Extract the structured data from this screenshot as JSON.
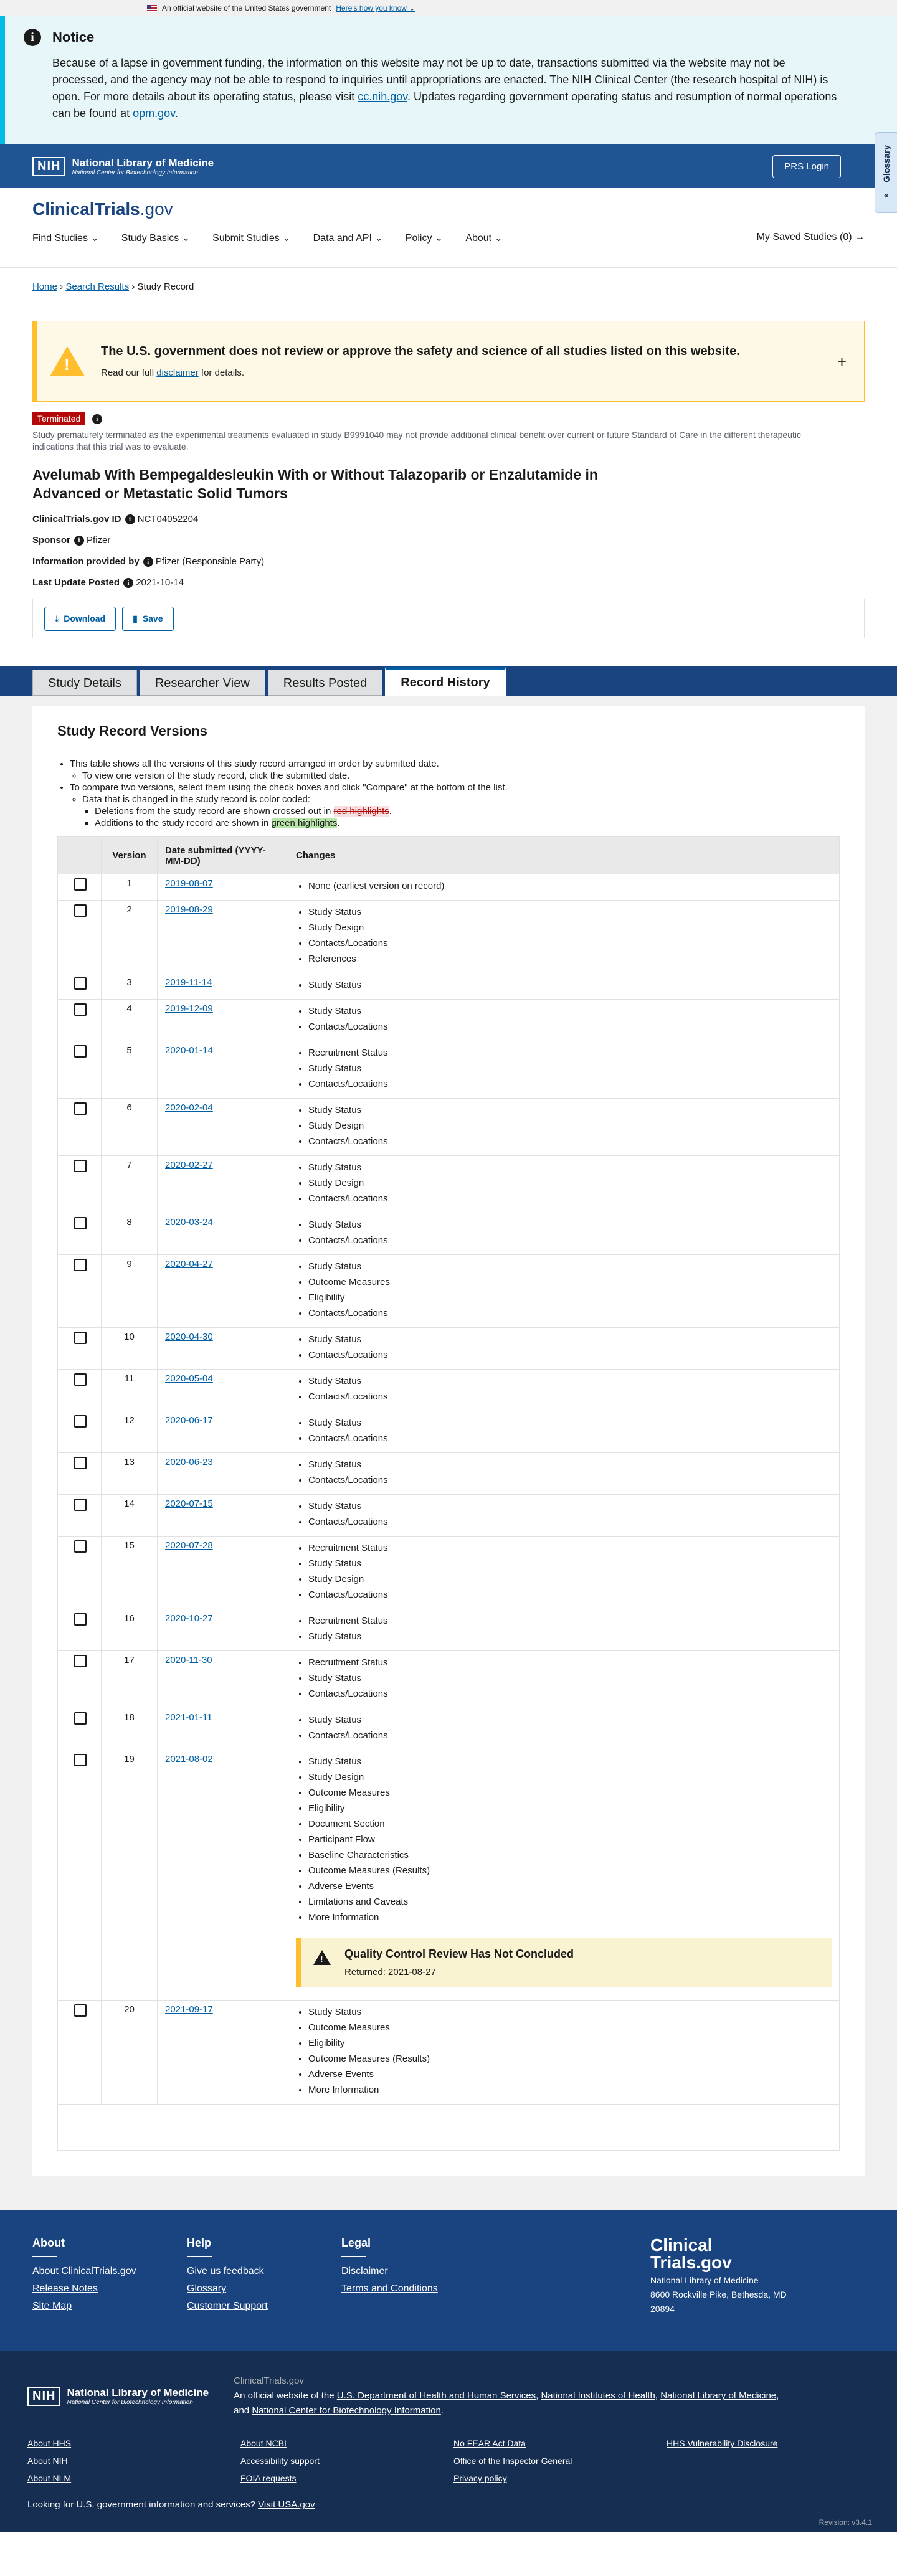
{
  "gov_banner": {
    "text": "An official website of the United States government",
    "link": "Here's how you know"
  },
  "notice": {
    "title": "Notice",
    "body_1": "Because of a lapse in government funding, the information on this website may not be up to date, transactions submitted via the website may not be processed, and the agency may not be able to respond to inquiries until appropriations are enacted. The NIH Clinical Center (the research hospital of NIH) is open. For more details about its operating status, please visit ",
    "link_1": "cc.nih.gov",
    "body_2": ". Updates regarding government operating status and resumption of normal operations can be found at ",
    "link_2": "opm.gov",
    "body_3": "."
  },
  "glossary_tab": "Glossary",
  "nih_bar": {
    "logo_box": "NIH",
    "logo_title": "National Library of Medicine",
    "logo_sub": "National Center for Biotechnology Information",
    "prs_login": "PRS Login"
  },
  "site": {
    "title_bold": "ClinicalTrials",
    "title_suffix": ".gov"
  },
  "nav": {
    "items": [
      "Find Studies",
      "Study Basics",
      "Submit Studies",
      "Data and API",
      "Policy",
      "About"
    ],
    "saved": "My Saved Studies (0)"
  },
  "breadcrumb": {
    "home": "Home",
    "search": "Search Results",
    "current": "Study Record"
  },
  "disclaimer": {
    "title": "The U.S. government does not review or approve the safety and science of all studies listed on this website.",
    "pre": "Read our full ",
    "link": "disclaimer",
    "post": " for details."
  },
  "study": {
    "status_badge": "Terminated",
    "reason": "Study prematurely terminated as the experimental treatments evaluated in study B9991040 may not provide additional clinical benefit over current or future Standard of Care in the different therapeutic indications that this trial was to evaluate.",
    "title": "Avelumab With Bempegaldesleukin With or Without Talazoparib or Enzalutamide in Advanced or Metastatic Solid Tumors",
    "id_label": "ClinicalTrials.gov ID",
    "id_value": "NCT04052204",
    "sponsor_label": "Sponsor",
    "sponsor_value": "Pfizer",
    "info_label": "Information provided by",
    "info_value": "Pfizer (Responsible Party)",
    "update_label": "Last Update Posted",
    "update_value": "2021-10-14"
  },
  "actions": {
    "download": "Download",
    "save": "Save"
  },
  "tabs": [
    "Study Details",
    "Researcher View",
    "Results Posted",
    "Record History"
  ],
  "versions": {
    "title": "Study Record Versions",
    "b1": "This table shows all the versions of this study record arranged in order by submitted date.",
    "b1a": "To view one version of the study record, click the submitted date.",
    "b2": "To compare two versions, select them using the check boxes and click \"Compare\" at the bottom of the list.",
    "b2a": "Data that is changed in the study record is color coded:",
    "b2a1_pre": "Deletions from the study record are shown crossed out in ",
    "b2a1_hl": "red highlights",
    "b2a1_post": ".",
    "b2a2_pre": "Additions to the study record are shown in ",
    "b2a2_hl": "green highlights",
    "b2a2_post": ".",
    "col_version": "Version",
    "col_date": "Date submitted (YYYY-MM-DD)",
    "col_changes": "Changes",
    "rows": [
      {
        "v": "1",
        "date": "2019-08-07",
        "changes": [
          "None (earliest version on record)"
        ]
      },
      {
        "v": "2",
        "date": "2019-08-29",
        "changes": [
          "Study Status",
          "Study Design",
          "Contacts/Locations",
          "References"
        ]
      },
      {
        "v": "3",
        "date": "2019-11-14",
        "changes": [
          "Study Status"
        ]
      },
      {
        "v": "4",
        "date": "2019-12-09",
        "changes": [
          "Study Status",
          "Contacts/Locations"
        ]
      },
      {
        "v": "5",
        "date": "2020-01-14",
        "changes": [
          "Recruitment Status",
          "Study Status",
          "Contacts/Locations"
        ]
      },
      {
        "v": "6",
        "date": "2020-02-04",
        "changes": [
          "Study Status",
          "Study Design",
          "Contacts/Locations"
        ]
      },
      {
        "v": "7",
        "date": "2020-02-27",
        "changes": [
          "Study Status",
          "Study Design",
          "Contacts/Locations"
        ]
      },
      {
        "v": "8",
        "date": "2020-03-24",
        "changes": [
          "Study Status",
          "Contacts/Locations"
        ]
      },
      {
        "v": "9",
        "date": "2020-04-27",
        "changes": [
          "Study Status",
          "Outcome Measures",
          "Eligibility",
          "Contacts/Locations"
        ]
      },
      {
        "v": "10",
        "date": "2020-04-30",
        "changes": [
          "Study Status",
          "Contacts/Locations"
        ]
      },
      {
        "v": "11",
        "date": "2020-05-04",
        "changes": [
          "Study Status",
          "Contacts/Locations"
        ]
      },
      {
        "v": "12",
        "date": "2020-06-17",
        "changes": [
          "Study Status",
          "Contacts/Locations"
        ]
      },
      {
        "v": "13",
        "date": "2020-06-23",
        "changes": [
          "Study Status",
          "Contacts/Locations"
        ]
      },
      {
        "v": "14",
        "date": "2020-07-15",
        "changes": [
          "Study Status",
          "Contacts/Locations"
        ]
      },
      {
        "v": "15",
        "date": "2020-07-28",
        "changes": [
          "Recruitment Status",
          "Study Status",
          "Study Design",
          "Contacts/Locations"
        ]
      },
      {
        "v": "16",
        "date": "2020-10-27",
        "changes": [
          "Recruitment Status",
          "Study Status"
        ]
      },
      {
        "v": "17",
        "date": "2020-11-30",
        "changes": [
          "Recruitment Status",
          "Study Status",
          "Contacts/Locations"
        ]
      },
      {
        "v": "18",
        "date": "2021-01-11",
        "changes": [
          "Study Status",
          "Contacts/Locations"
        ]
      },
      {
        "v": "19",
        "date": "2021-08-02",
        "changes": [
          "Study Status",
          "Study Design",
          "Outcome Measures",
          "Eligibility",
          "Document Section",
          "Participant Flow",
          "Baseline Characteristics",
          "Outcome Measures (Results)",
          "Adverse Events",
          "Limitations and Caveats",
          "More Information"
        ],
        "qc": {
          "title": "Quality Control Review Has Not Concluded",
          "text": "Returned: 2021-08-27"
        }
      },
      {
        "v": "20",
        "date": "2021-09-17",
        "changes": [
          "Study Status",
          "Outcome Measures",
          "Eligibility",
          "Outcome Measures (Results)",
          "Adverse Events",
          "More Information"
        ]
      }
    ]
  },
  "footer": {
    "cols": [
      {
        "title": "About",
        "links": [
          "About ClinicalTrials.gov",
          "Release Notes",
          "Site Map"
        ]
      },
      {
        "title": "Help",
        "links": [
          "Give us feedback",
          "Glossary",
          "Customer Support"
        ]
      },
      {
        "title": "Legal",
        "links": [
          "Disclaimer",
          "Terms and Conditions"
        ]
      }
    ],
    "brand_1": "Clinical",
    "brand_2": "Trials.gov",
    "address_1": "National Library of Medicine",
    "address_2": "8600 Rockville Pike, Bethesda, MD",
    "address_3": "20894",
    "ctg": "ClinicalTrials.gov",
    "official_pre": "An official website of the ",
    "hhs": "U.S. Department of Health and Human Services",
    "nih": "National Institutes of Health",
    "nlm": "National Library of Medicine",
    "and": "and ",
    "ncbi": "National Center for Biotechnology Information",
    "links": [
      "About HHS",
      "About NCBI",
      "No FEAR Act Data",
      "HHS Vulnerability Disclosure",
      "About NIH",
      "Accessibility support",
      "Office of the Inspector General",
      "About NLM",
      "FOIA requests",
      "Privacy policy"
    ],
    "usa_pre": "Looking for U.S. government information and services?",
    "usa_link": "Visit USA.gov",
    "revision": "Revision: v3.4.1"
  }
}
